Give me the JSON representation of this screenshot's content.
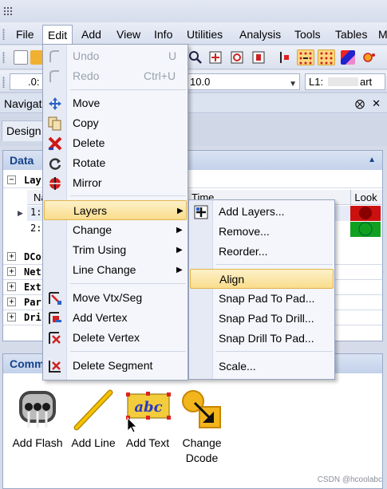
{
  "menubar": {
    "items": [
      "File",
      "Edit",
      "Add",
      "View",
      "Info",
      "Utilities",
      "Analysis",
      "Tools",
      "Tables",
      "M"
    ]
  },
  "toolbar2": {
    "combo1": ".0:",
    "combo2": "10.0",
    "combo3": "L1:",
    "combo3_tail": "art"
  },
  "navigator": {
    "title": "Navigat",
    "pin": "⨂",
    "close": "✕",
    "tab": "Design"
  },
  "data_panel": {
    "title": "Data",
    "layers_node": "Lay",
    "col_name": "Na",
    "col_time": "Time",
    "col_look": "Look",
    "rows": [
      {
        "num": "1:",
        "look": "red"
      },
      {
        "num": "2:",
        "look": "green"
      }
    ],
    "other_nodes": [
      "DCo",
      "Net",
      "Ext",
      "Par",
      "Dri"
    ]
  },
  "commands_panel": {
    "title": "Comm",
    "commands": [
      {
        "label": "Add Flash"
      },
      {
        "label": "Add Line"
      },
      {
        "label": "Add Text"
      },
      {
        "label": "Change Dcode"
      }
    ]
  },
  "edit_menu": {
    "items": [
      {
        "label": "Undo",
        "shortcut": "U",
        "disabled": true
      },
      {
        "label": "Redo",
        "shortcut": "Ctrl+U",
        "disabled": true
      },
      {
        "label": "Move"
      },
      {
        "label": "Copy"
      },
      {
        "label": "Delete"
      },
      {
        "label": "Rotate"
      },
      {
        "label": "Mirror"
      },
      {
        "label": "Layers"
      },
      {
        "label": "Change"
      },
      {
        "label": "Trim Using"
      },
      {
        "label": "Line Change"
      },
      {
        "label": "Move Vtx/Seg"
      },
      {
        "label": "Add Vertex"
      },
      {
        "label": "Delete Vertex"
      },
      {
        "label": "Delete Segment"
      }
    ]
  },
  "layers_submenu": {
    "items": [
      {
        "label": "Add Layers..."
      },
      {
        "label": "Remove..."
      },
      {
        "label": "Reorder..."
      },
      {
        "label": "Align"
      },
      {
        "label": "Snap Pad To Pad..."
      },
      {
        "label": "Snap Pad To Drill..."
      },
      {
        "label": "Snap Drill To Pad..."
      },
      {
        "label": "Scale..."
      }
    ]
  },
  "watermark": "CSDN @hcoolabc",
  "colors": {
    "accent_highlight": "#f9dc8c",
    "panel_header_text": "#15428b",
    "look_red": "#cc1010",
    "look_green": "#10a020"
  }
}
